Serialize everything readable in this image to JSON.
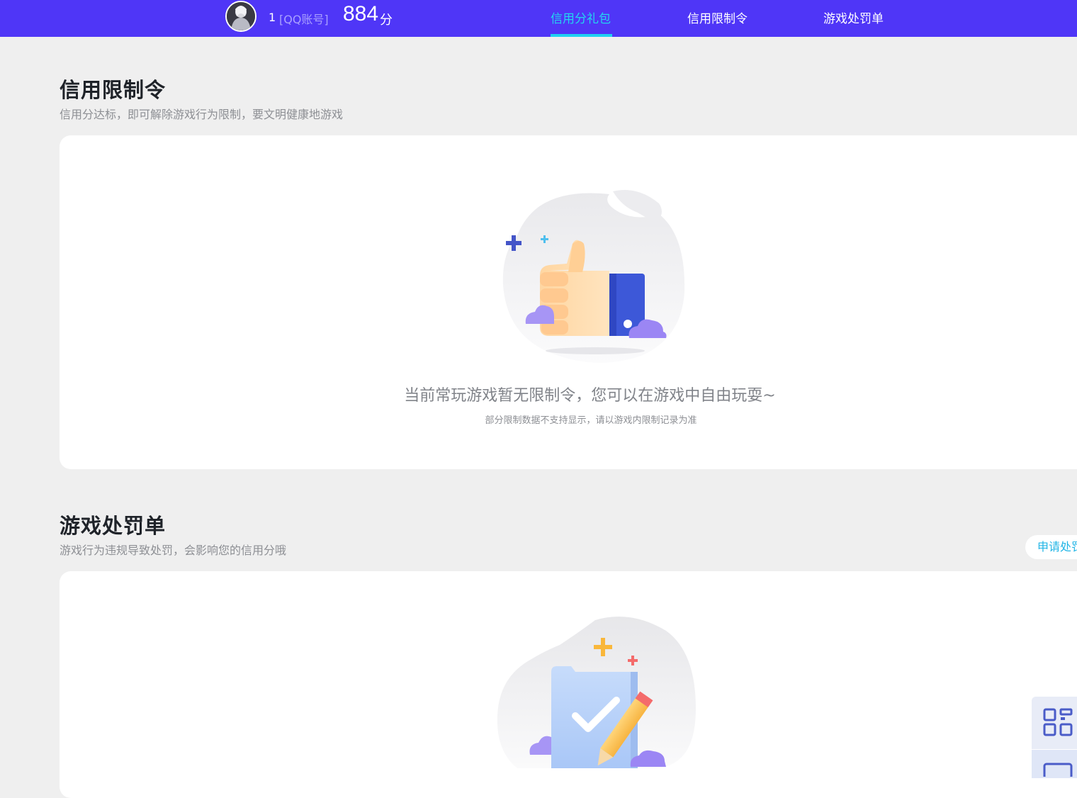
{
  "header": {
    "user_number": "1",
    "account_type": "[QQ账号]",
    "score": "884",
    "score_unit": "分",
    "tabs": [
      {
        "label": "信用分礼包",
        "active": true
      },
      {
        "label": "信用限制令",
        "active": false
      },
      {
        "label": "游戏处罚单",
        "active": false
      }
    ]
  },
  "restriction_section": {
    "title": "信用限制令",
    "subtitle": "信用分达标，即可解除游戏行为限制，要文明健康地游戏",
    "empty_message": "当前常玩游戏暂无限制令，您可以在游戏中自由玩耍~",
    "empty_note": "部分限制数据不支持显示，请以游戏内限制记录为准"
  },
  "penalty_section": {
    "title": "游戏处罚单",
    "subtitle": "游戏行为违规导致处罚，会影响您的信用分哦",
    "apply_button": "申请处罚"
  },
  "floating_panel": {
    "icons": [
      "qr-code-icon",
      "screen-icon"
    ]
  },
  "colors": {
    "topbar": "#4f36f7",
    "active_tab": "#22d6f0",
    "page_background": "#efefef",
    "card_background": "#ffffff",
    "link": "#22b5e6"
  }
}
